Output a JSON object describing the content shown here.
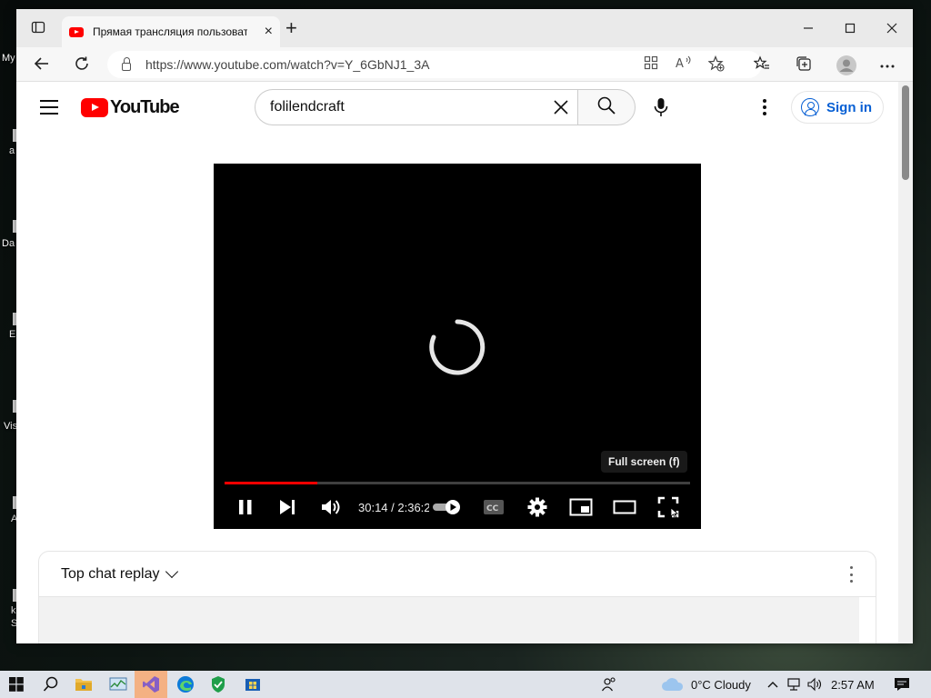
{
  "desktop": {
    "icon_labels": [
      "My",
      "a",
      "Da",
      "E",
      "Vis",
      "A",
      "k",
      "S"
    ]
  },
  "browser": {
    "tab_title": "Прямая трансляция пользовате",
    "tab_close": "×",
    "new_tab": "+",
    "window_controls": {
      "minimize": "—",
      "maximize": "☐",
      "close": "✕"
    },
    "url": "https://www.youtube.com/watch?v=Y_6GbNJ1_3A"
  },
  "youtube": {
    "logo_text": "YouTube",
    "search": {
      "value": "folilendcraft",
      "placeholder": "Search"
    },
    "sign_in_label": "Sign in",
    "player": {
      "progress_fraction": 0.2,
      "time": "30:14 / 2:36:2",
      "tooltip": "Full screen (f)",
      "cc_label": "CC"
    },
    "chat": {
      "title": "Top chat replay"
    }
  },
  "taskbar": {
    "weather": "0°C  Cloudy",
    "time": "2:57 AM"
  },
  "colors": {
    "yt_red": "#ff0000",
    "link_blue": "#065fd4",
    "edge_blue": "#0c7bd8"
  }
}
